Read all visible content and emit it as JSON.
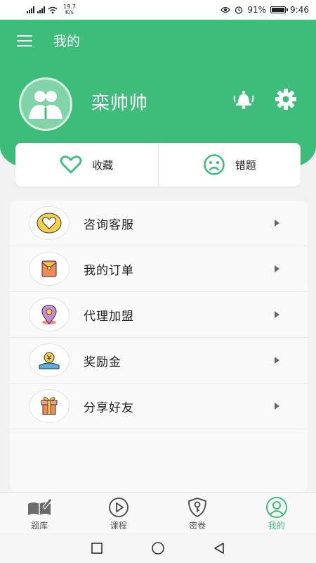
{
  "status_bar": {
    "network_speed": "19.7",
    "network_speed_unit": "K/s",
    "battery": "91%",
    "time": "9:46"
  },
  "header": {
    "title": "我的",
    "username": "栾帅帅"
  },
  "quick_actions": [
    {
      "label": "收藏",
      "icon": "heart-icon"
    },
    {
      "label": "错题",
      "icon": "sad-face-icon"
    }
  ],
  "menu": [
    {
      "label": "咨询客服",
      "icon": "heart-badge-icon"
    },
    {
      "label": "我的订单",
      "icon": "envelope-icon"
    },
    {
      "label": "代理加盟",
      "icon": "location-pin-icon"
    },
    {
      "label": "奖励金",
      "icon": "reward-money-icon"
    },
    {
      "label": "分享好友",
      "icon": "gift-icon"
    }
  ],
  "tabs": [
    {
      "label": "题库",
      "icon": "book-pen-icon"
    },
    {
      "label": "课程",
      "icon": "play-circle-icon"
    },
    {
      "label": "密卷",
      "icon": "shield-key-icon"
    },
    {
      "label": "我的",
      "icon": "user-circle-icon",
      "active": true
    }
  ],
  "colors": {
    "brand": "#3dbd79",
    "background": "#f2f2f2"
  }
}
